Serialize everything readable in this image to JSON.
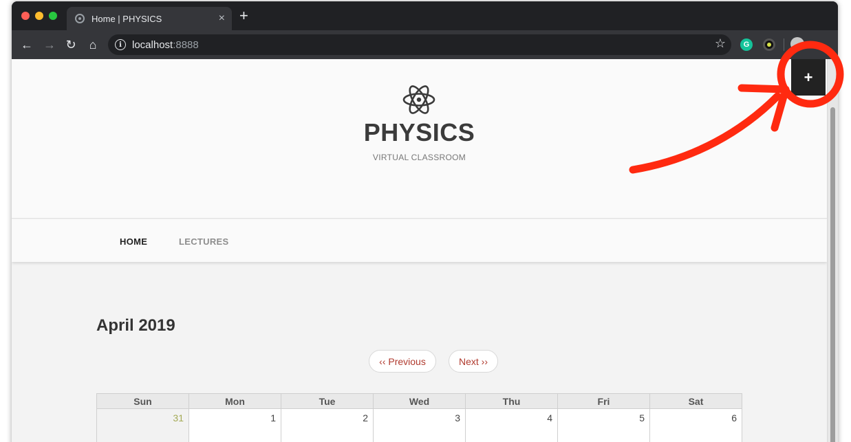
{
  "browser": {
    "tab_title": "Home | PHYSICS",
    "tab_close": "×",
    "new_tab": "+",
    "url_host": "localhost",
    "url_port": ":8888",
    "extension_g": "G"
  },
  "site": {
    "title": "PHYSICS",
    "tagline": "VIRTUAL CLASSROOM",
    "nav": [
      "HOME",
      "LECTURES"
    ]
  },
  "calendar": {
    "month": "April 2019",
    "prev_label": "‹‹ Previous",
    "next_label": "Next ››",
    "weekdays": [
      "Sun",
      "Mon",
      "Tue",
      "Wed",
      "Thu",
      "Fri",
      "Sat"
    ],
    "days": [
      "31",
      "1",
      "2",
      "3",
      "4",
      "5",
      "6"
    ]
  },
  "admin": {
    "plus_label": "+"
  },
  "colors": {
    "annotation": "#ff2a10",
    "link_red": "#b03a2e",
    "prev_month_day": "#a4aa55"
  }
}
